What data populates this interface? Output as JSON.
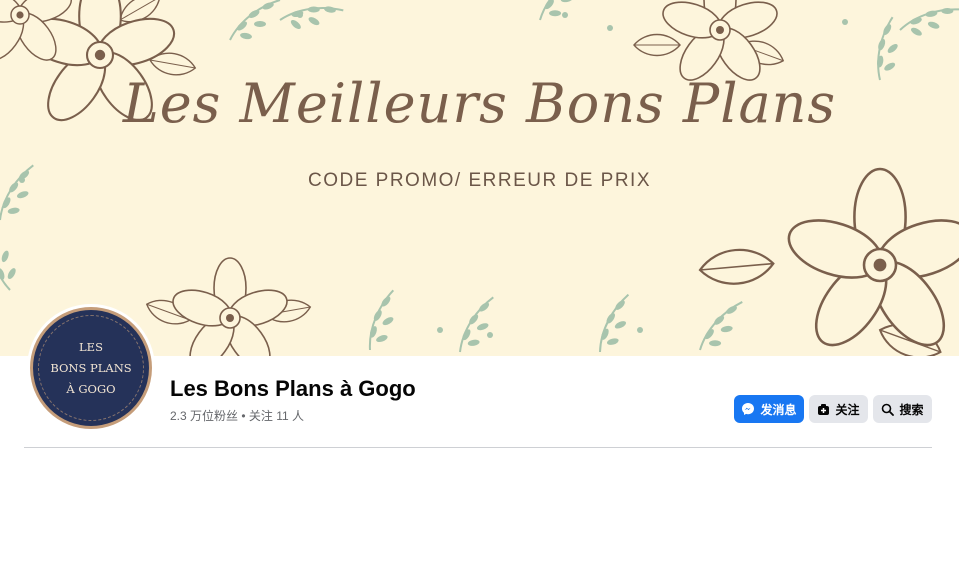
{
  "cover": {
    "title": "Les Meilleurs Bons Plans",
    "subtitle": "CODE PROMO/ ERREUR DE PRIX",
    "background_color": "#fdf5dc",
    "flower_color": "#7a5f4c",
    "leaf_color": "#a8c4ad"
  },
  "avatar": {
    "line1": "LES",
    "line2": "BONS PLANS",
    "line3": "À GOGO",
    "background_color": "#253259",
    "ring_color": "#c59d7a"
  },
  "page": {
    "name": "Les Bons Plans à Gogo",
    "meta": "2.3 万位粉丝 • 关注 11 人"
  },
  "actions": {
    "message_label": "发消息",
    "message_icon": "messenger-icon",
    "follow_label": "关注",
    "follow_icon": "follow-icon",
    "search_label": "搜索",
    "search_icon": "search-icon",
    "accent_color": "#1877f2"
  }
}
